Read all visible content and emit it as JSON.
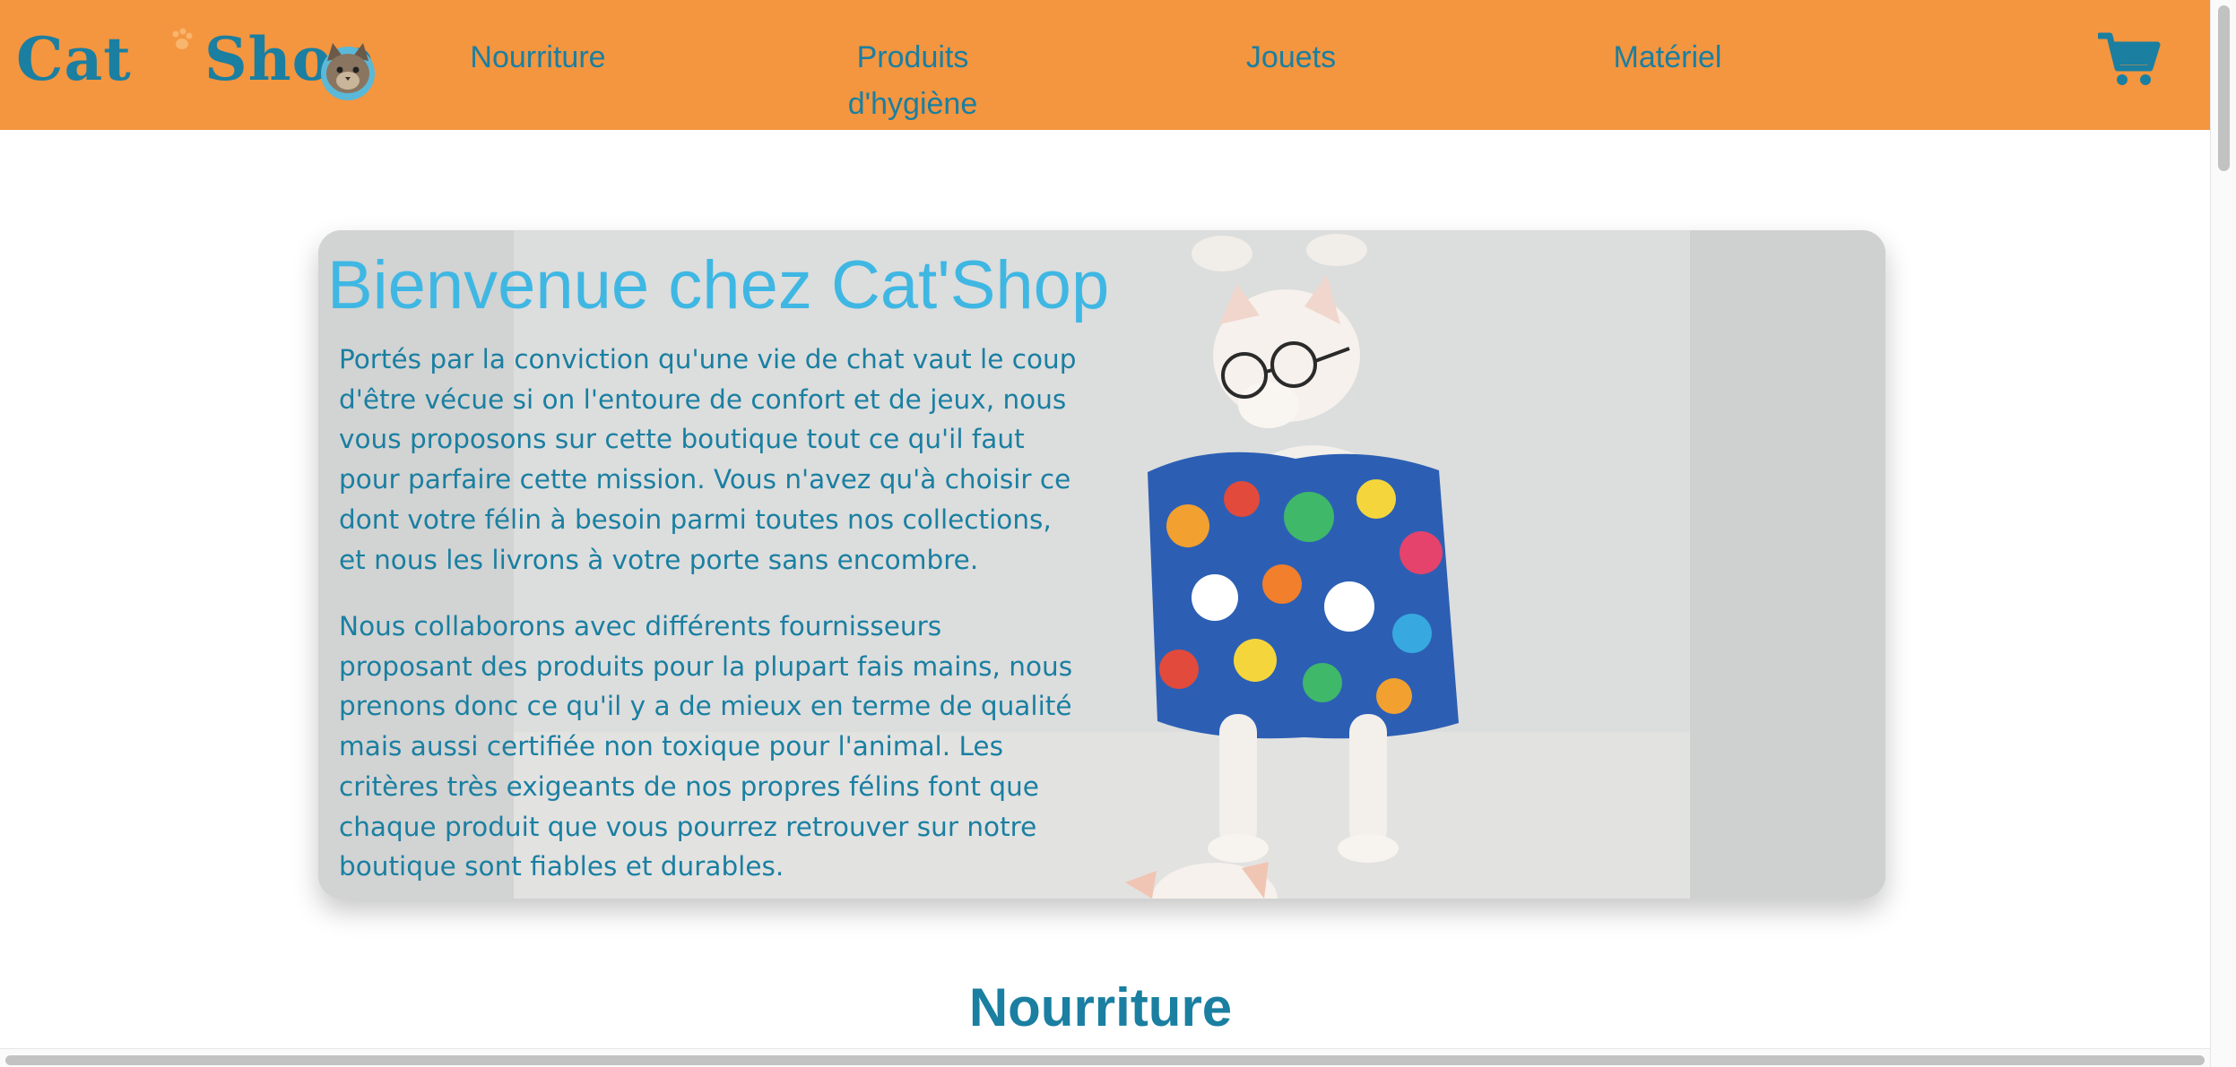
{
  "header": {
    "logo": {
      "text_cat": "Cat",
      "text_shop": "Shop",
      "alt": "Cat Shop"
    },
    "nav": [
      {
        "label": "Nourriture"
      },
      {
        "label_line1": "Produits",
        "label_line2": "d'hygiène"
      },
      {
        "label": "Jouets"
      },
      {
        "label": "Matériel"
      }
    ],
    "cart_icon": "shopping-cart-icon"
  },
  "hero": {
    "title": "Bienvenue chez Cat'Shop",
    "paragraph_1": "Portés par la conviction qu'une vie de chat vaut le coup d'être vécue si on l'entoure de confort et de jeux, nous vous proposons sur cette boutique tout ce qu'il faut pour parfaire cette mission. Vous n'avez qu'à choisir ce dont votre félin à besoin parmi toutes nos collections, et nous les livrons à votre porte sans encombre.",
    "paragraph_2": "Nous collaborons avec différents fournisseurs proposant des produits pour la plupart fais mains, nous prenons donc ce qu'il y a de mieux en terme de qualité mais aussi certifiée non toxique pour l'animal. Les critères très exigeants de nos propres félins font que chaque produit que vous pourrez retrouver sur notre boutique sont fiables et durables.",
    "image": "cat-wearing-glasses-and-hawaiian-shirt"
  },
  "section": {
    "title": "Nourriture"
  },
  "colors": {
    "header_bg": "#f4953f",
    "brand_blue": "#1a7fa1",
    "title_blue": "#3fb7e3",
    "hero_bg": "#d3d3d3"
  }
}
